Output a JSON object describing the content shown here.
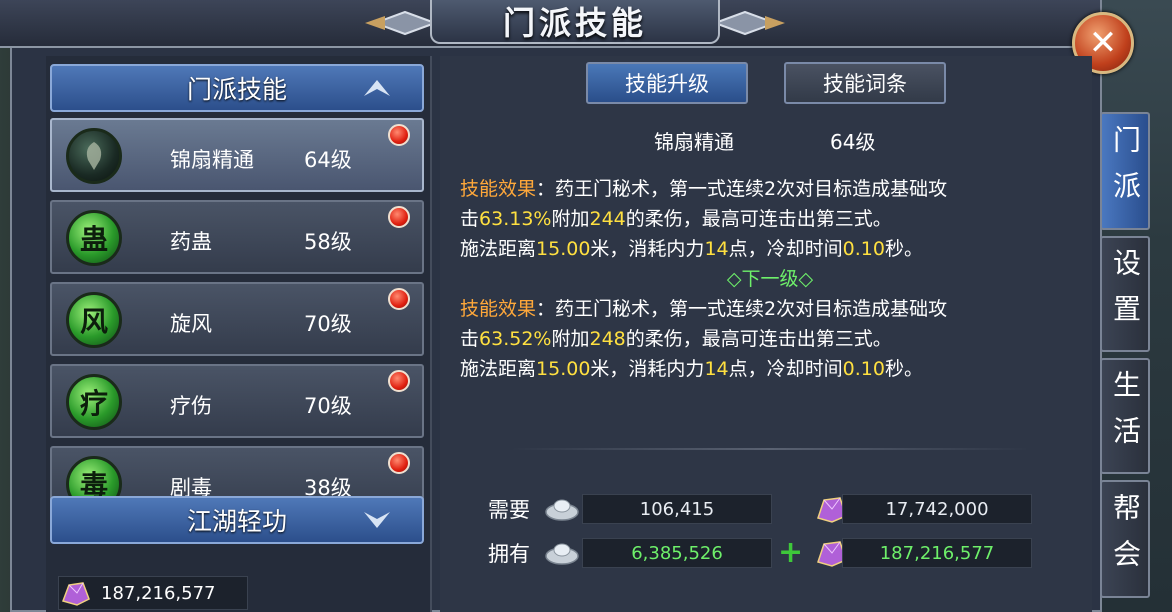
{
  "window": {
    "title": "门派技能",
    "close_icon": "close-icon"
  },
  "left_panel": {
    "section1_label": "门派技能",
    "section2_label": "江湖轻功",
    "skills": [
      {
        "name": "锦扇精通",
        "level": "64级",
        "icon_char": "",
        "selected": true
      },
      {
        "name": "药蛊",
        "level": "58级",
        "icon_char": "蛊",
        "selected": false
      },
      {
        "name": "旋风",
        "level": "70级",
        "icon_char": "风",
        "selected": false
      },
      {
        "name": "疗伤",
        "level": "70级",
        "icon_char": "疗",
        "selected": false
      },
      {
        "name": "剧毒",
        "level": "38级",
        "icon_char": "毒",
        "selected": false
      }
    ],
    "currency_value": "187,216,577"
  },
  "tabs": {
    "upgrade": "技能升级",
    "entries": "技能词条"
  },
  "detail": {
    "skill_name": "锦扇精通",
    "skill_level": "64级",
    "current": {
      "label": "技能效果",
      "line1_rest": "：药王门秘术，第一式连续2次对目标造成基础攻",
      "line2_pre": "击",
      "line2_pct": "63.13%",
      "line2_mid": "附加",
      "line2_val": "244",
      "line2_post": "的柔伤，最高可连击出第三式。",
      "line3_pre": "施法距离",
      "line3_dist": "15.00",
      "line3_mid1": "米，消耗内力",
      "line3_cost": "14",
      "line3_mid2": "点，冷却时间",
      "line3_cd": "0.10",
      "line3_post": "秒。"
    },
    "next_header": "◇下一级◇",
    "next": {
      "label": "技能效果",
      "line1_rest": "：药王门秘术，第一式连续2次对目标造成基础攻",
      "line2_pre": "击",
      "line2_pct": "63.52%",
      "line2_mid": "附加",
      "line2_val": "248",
      "line2_post": "的柔伤，最高可连击出第三式。",
      "line3_pre": "施法距离",
      "line3_dist": "15.00",
      "line3_mid1": "米，消耗内力",
      "line3_cost": "14",
      "line3_mid2": "点，冷却时间",
      "line3_cd": "0.10",
      "line3_post": "秒。"
    }
  },
  "costs": {
    "need_label": "需要",
    "have_label": "拥有",
    "need_silver": "106,415",
    "need_gem": "17,742,000",
    "have_silver": "6,385,526",
    "have_gem": "187,216,577"
  },
  "side_tabs": [
    {
      "label": "门派",
      "active": true
    },
    {
      "label": "设置",
      "active": false
    },
    {
      "label": "生活",
      "active": false
    },
    {
      "label": "帮会",
      "active": false
    }
  ],
  "colors": {
    "highlight_orange": "#ffa83a",
    "highlight_yellow": "#ffe040",
    "next_green": "#6ef06a",
    "have_green": "#6ef06a"
  }
}
